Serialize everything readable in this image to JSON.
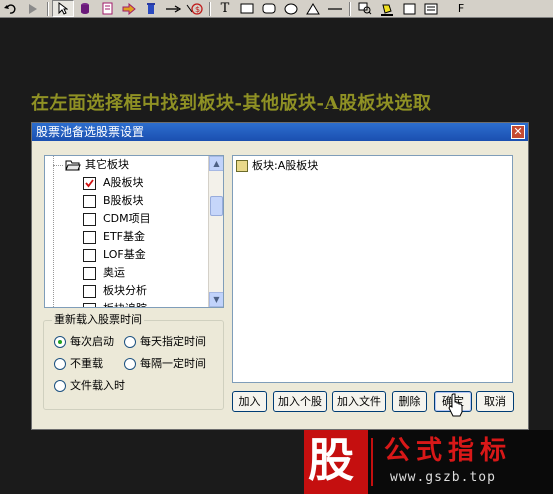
{
  "toolbar": {
    "items": [
      "undo-icon",
      "play-icon",
      "pointer-icon",
      "cylinder-icon",
      "document-icon",
      "arrow-shape-icon",
      "trash-icon",
      "line-arrow-icon",
      "arrow-circle-icon",
      "text-icon",
      "rectangle-icon",
      "rounded-rectangle-icon",
      "ellipse-icon",
      "triangle-icon",
      "line-icon",
      "zoom-icon",
      "fill-icon",
      "square-icon",
      "list-icon"
    ],
    "text_label": "T",
    "f_label": "F"
  },
  "caption": "在左面选择框中找到板块-其他版块-A股板块选取",
  "dialog": {
    "title": "股票池备选股票设置",
    "close_label": "✕",
    "tree": {
      "header_label": "其它板块",
      "items": [
        {
          "label": "A股板块",
          "checked": true
        },
        {
          "label": "B股板块",
          "checked": false
        },
        {
          "label": "CDM项目",
          "checked": false
        },
        {
          "label": "ETF基金",
          "checked": false
        },
        {
          "label": "LOF基金",
          "checked": false
        },
        {
          "label": "奥运",
          "checked": false
        },
        {
          "label": "板块分析",
          "checked": false
        },
        {
          "label": "板块追踪",
          "checked": false
        }
      ]
    },
    "reload_group": {
      "title": "重新载入股票时间",
      "options": [
        {
          "label": "每次启动",
          "checked": true
        },
        {
          "label": "每天指定时间",
          "checked": false
        },
        {
          "label": "不重载",
          "checked": false
        },
        {
          "label": "每隔一定时间",
          "checked": false
        },
        {
          "label": "文件载入时",
          "checked": false
        }
      ]
    },
    "selected_list": {
      "items": [
        "板块:A股板块"
      ]
    },
    "buttons": {
      "add": "加入",
      "add_stock": "加入个股",
      "add_file": "加入文件",
      "delete": "删除",
      "ok": "确定",
      "cancel": "取消"
    }
  },
  "watermark": {
    "logo_char": "股",
    "name": "公式指标",
    "url": "www.gszb.top"
  },
  "colors": {
    "caption": "#8f9124",
    "titlebar": "#2d6ecf",
    "logo_red": "#c50f0f",
    "checkmark": "#d01010"
  }
}
